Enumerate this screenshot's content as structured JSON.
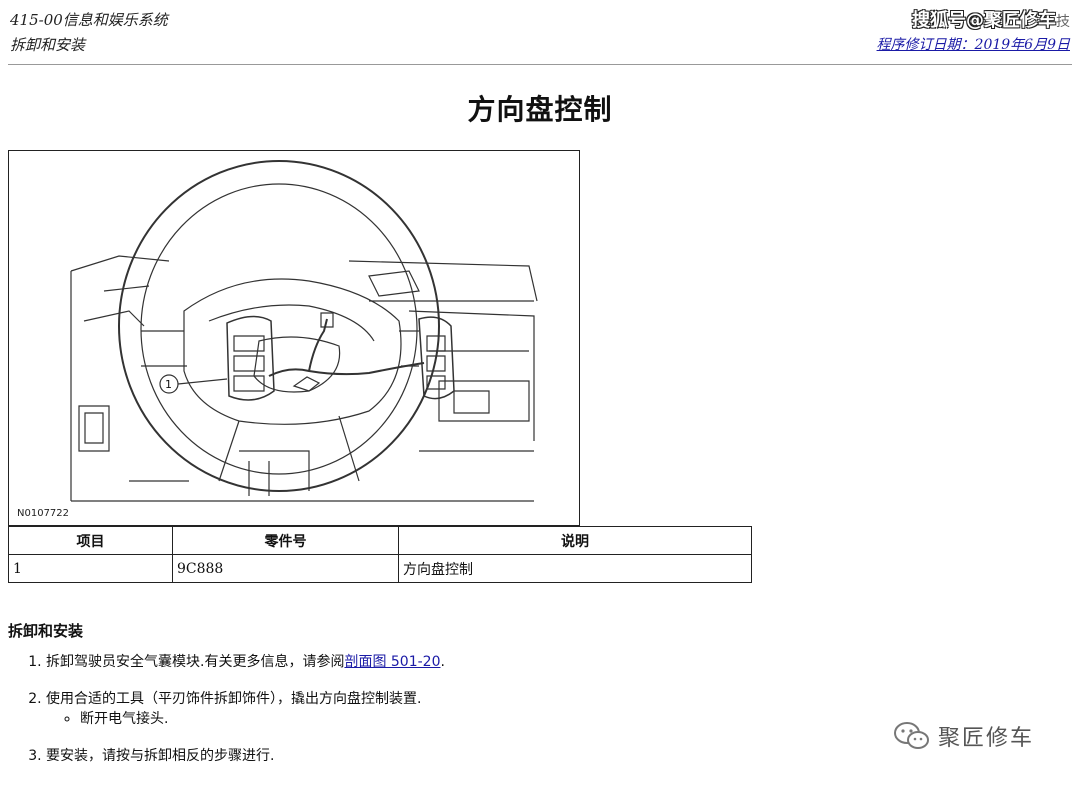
{
  "header": {
    "section_code": "415-00信息和娱乐系统",
    "section_sub": "拆卸和安装",
    "watermark": "搜狐号@聚匠修车",
    "watermark_tail": "技",
    "revision_date": "程序修订日期：2019年6月9日"
  },
  "page_title": "方向盘控制",
  "figure": {
    "figure_id": "N0107722",
    "callout": "1",
    "icon": "steering-wheel-controls-illustration"
  },
  "parts_table": {
    "headers": [
      "项目",
      "零件号",
      "说明"
    ],
    "rows": [
      {
        "item": "1",
        "part_no": "9C888",
        "desc": "方向盘控制"
      }
    ]
  },
  "procedure": {
    "heading": "拆卸和安装",
    "steps": [
      {
        "text": "拆卸驾驶员安全气囊模块.有关更多信息，请参阅",
        "link": "剖面图 501-20",
        "suffix": "."
      },
      {
        "text": "使用合适的工具（平刃饰件拆卸饰件），撬出方向盘控制装置.",
        "sub": "断开电气接头."
      },
      {
        "text": "要安装，请按与拆卸相反的步骤进行."
      }
    ]
  },
  "brand": {
    "name": "聚匠修车",
    "icon": "wechat-icon"
  }
}
